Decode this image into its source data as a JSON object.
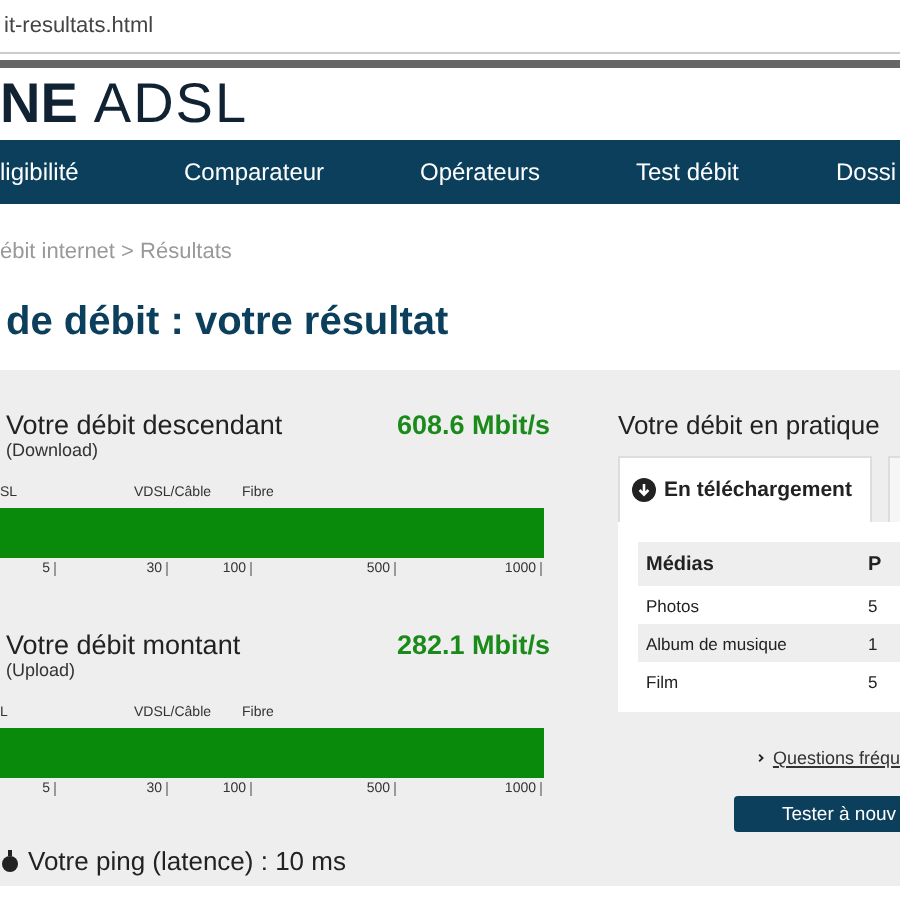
{
  "address_bar": {
    "url": "it-resultats.html"
  },
  "logo": {
    "bold": "NE",
    "light": "ADSL"
  },
  "nav": [
    "ligibilité",
    "Comparateur",
    "Opérateurs",
    "Test débit",
    "Dossi"
  ],
  "breadcrumb": "ébit internet > Résultats",
  "title": "de débit : votre résultat",
  "speeds": [
    {
      "title": "Votre débit descendant",
      "subtitle": "(Download)",
      "value": "608.6 Mbit/s",
      "zones": [
        "SL",
        "VDSL/Câble",
        "Fibre"
      ],
      "level": 1,
      "ticks": [
        "5",
        "30",
        "100",
        "500",
        "1000"
      ]
    },
    {
      "title": "Votre débit montant",
      "subtitle": "(Upload)",
      "value": "282.1 Mbit/s",
      "zones": [
        "L",
        "VDSL/Câble",
        "Fibre"
      ],
      "level": 1,
      "ticks": [
        "5",
        "30",
        "100",
        "500",
        "1000"
      ]
    }
  ],
  "ping": "Votre ping (latence) : 10 ms",
  "practice": {
    "title": "Votre débit en pratique",
    "tabs": [
      {
        "label": "En téléchargement",
        "selected": true
      },
      {
        "selected": false
      }
    ],
    "columns": [
      "Médias",
      "P"
    ],
    "rows": [
      [
        "Photos",
        "5"
      ],
      [
        "Album de musique",
        "1"
      ],
      [
        "Film",
        "5"
      ]
    ]
  },
  "faq_link": "Questions fréqu",
  "retest_button": "Tester à nouv"
}
